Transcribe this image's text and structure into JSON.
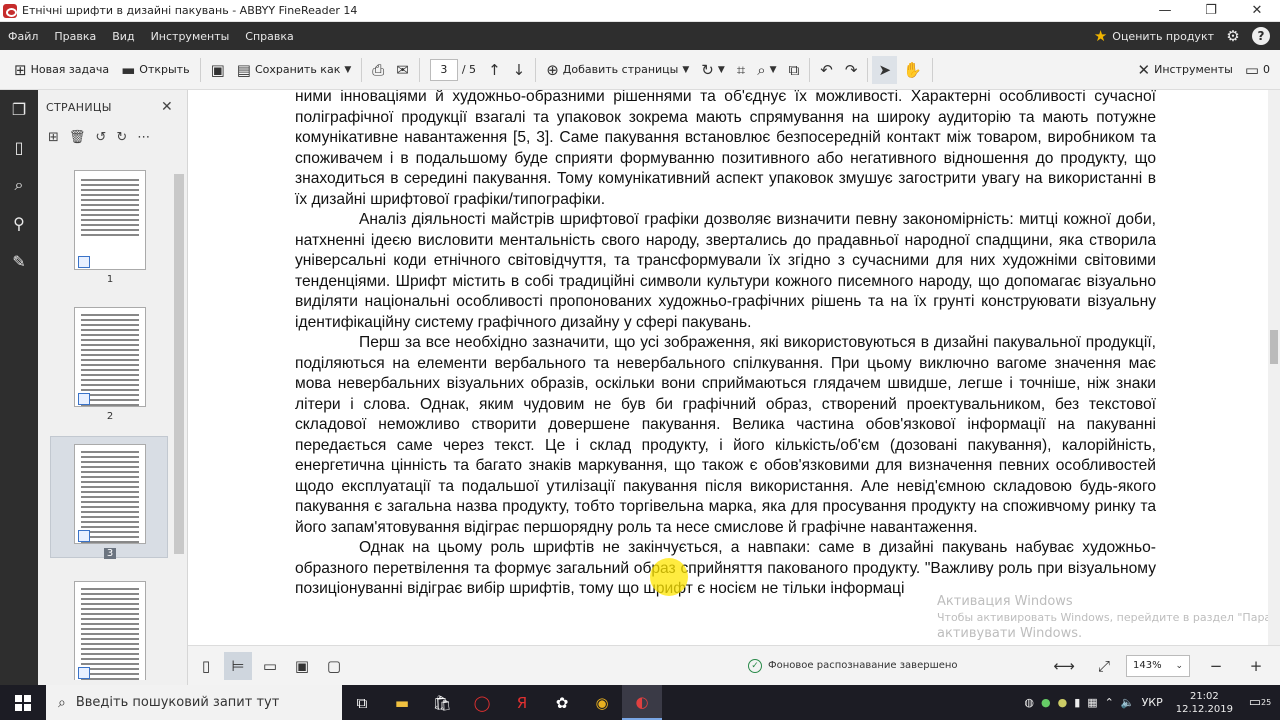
{
  "window": {
    "title": "Етнічні шрифти в дизайні пакувань - ABBYY FineReader 14",
    "minimize": "—",
    "restore": "❐",
    "close": "✕"
  },
  "menu": {
    "items": [
      "Файл",
      "Правка",
      "Вид",
      "Инструменты",
      "Справка"
    ],
    "rate_label": "Оценить продукт"
  },
  "toolbar": {
    "new_task": "Новая задача",
    "open": "Открыть",
    "save_as": "Сохранить как",
    "page_current": "3",
    "page_total": "/ 5",
    "add_pages": "Добавить страницы",
    "tools": "Инструменты",
    "comments_count": "0"
  },
  "pages_panel": {
    "title": "СТРАНИЦЫ",
    "pages": [
      "1",
      "2",
      "3",
      ""
    ],
    "selected": "3"
  },
  "document": {
    "paragraphs": [
      "ними інноваціями й художньо-образними рішеннями та об'єднує їх можливості. Характерні особливості сучасної поліграфічної продукції взагалі та упаковок зокрема мають спрямування на широку аудиторію та мають потужне комунікативне навантаження [5, 3]. Саме пакування встановлює безпосередній контакт між товаром, виробником та споживачем і в подальшому буде сприяти формуванню позитивного або негативного відношення до продукту, що знаходиться в середині пакування. Тому комунікативний аспект упаковок змушує загострити увагу на використанні в їх дизайні шрифтової графіки/типографіки.",
      "Аналіз діяльності майстрів шрифтової графіки дозволяє визначити певну закономірність: митці кожної доби, натхненні ідеєю висловити ментальність свого народу, звертались до прадавньої народної спадщини, яка створила універсальні коди етнічного світовідчуття, та трансформували їх згідно з сучасними для них художніми світовими тенденціями. Шрифт містить в собі традиційні символи культури кожного писемного народу, що допомагає візуально виділяти національні особливості пропонованих художньо-графічних рішень та на їх грунті конструювати візуальну ідентифікаційну систему графічного дизайну у сфері пакувань.",
      "Перш за все необхідно зазначити, що усі зображення, які використовуються в дизайні пакувальної продукції, поділяються на елементи вербального та невербального спілкування. При цьому виключно вагоме значення має мова невербальних візуальних образів, оскільки вони сприймаються глядачем швидше, легше і точніше, ніж знаки літери і слова. Однак, яким чудовим не був би графічний образ, створений проектувальником, без текстової складової неможливо створити довершене пакування. Велика частина обов'язкової інформації на пакуванні передається саме через текст. Це і склад продукту, і його кількість/об'єм (дозовані пакування), калорійність, енергетична цінність та багато знаків маркування, що також є обов'язковими для визначення певних особливостей щодо експлуатації та подальшої утилізації пакування після використання. Але невід'ємною складовою будь-якого пакування є загальна назва продукту, тобто торгівельна марка, яка для просування продукту на споживчому ринку та його запам'ятовування відіграє першорядну роль та несе смислове й графічне навантаження.",
      "Однак на цьому роль шрифтів не закінчується, а навпаки: саме в дизайні пакувань набуває художньо-образного перетвілення та формує загальний образ сприйняття пакованого продукту. \"Важливу роль при візуальному позиціонуванні відіграє вибір шрифтів, тому що шрифт є носієм не тільки інформаці"
    ]
  },
  "watermark": {
    "line1": "Активация Windows",
    "line2": "Чтобы активировать Windows, перейдите в раздел \"Параметры\", щоб",
    "line3": "активувати Windows."
  },
  "status": {
    "background_recognition": "Фоновое распознавание завершено",
    "zoom": "143%"
  },
  "taskbar": {
    "search_placeholder": "Введіть пошуковий запит тут",
    "language": "УКР",
    "time": "21:02",
    "date": "12.12.2019",
    "notifications": "25"
  }
}
